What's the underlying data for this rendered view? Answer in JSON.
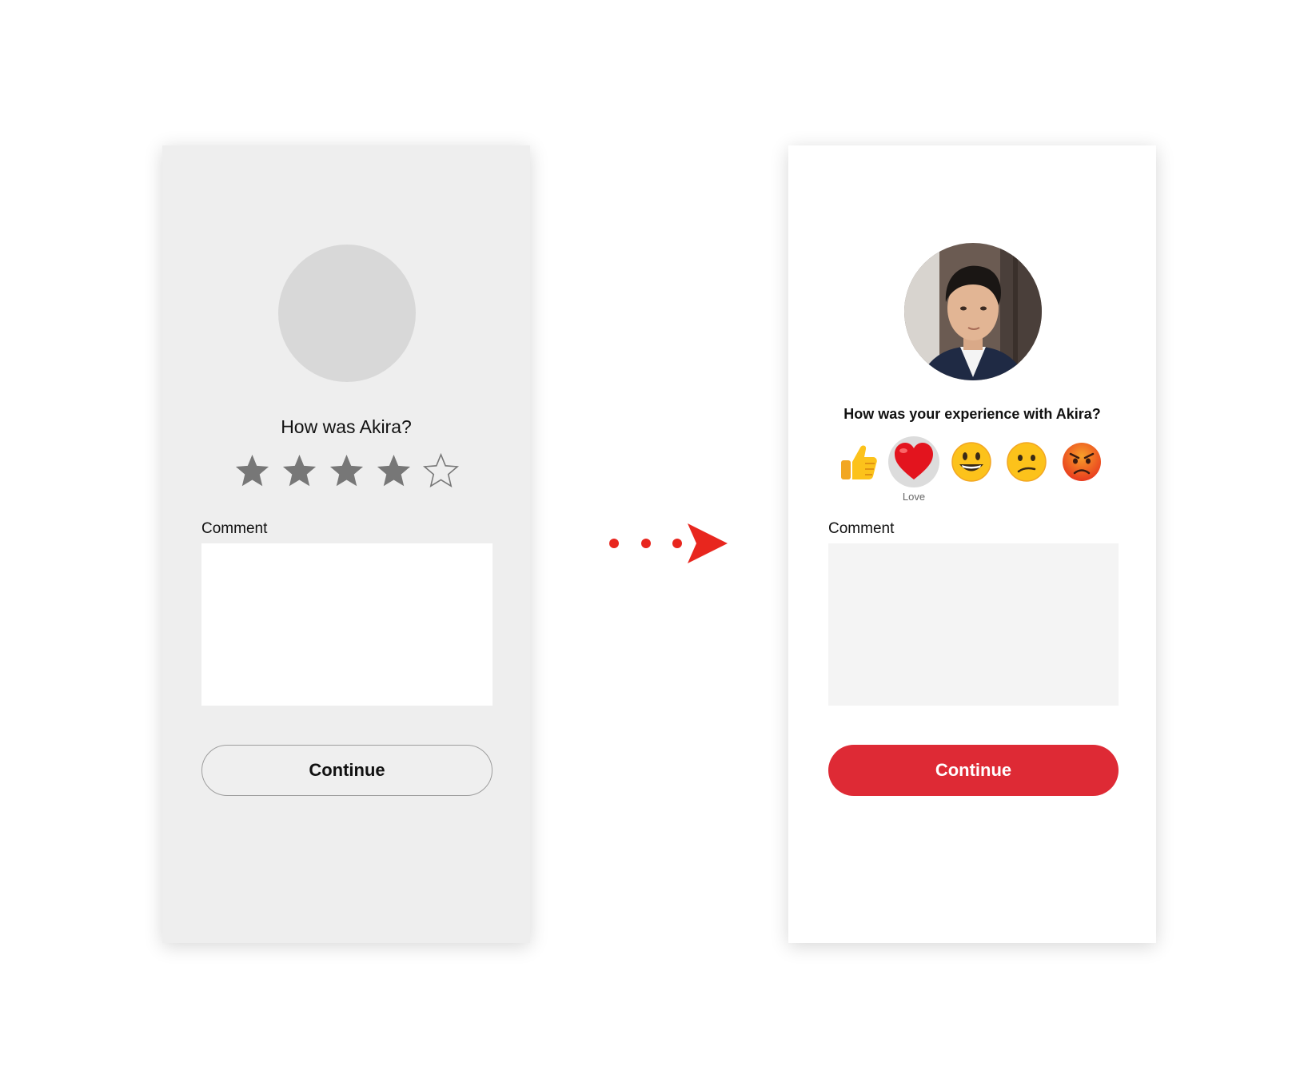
{
  "wireframe": {
    "question": "How was Akira?",
    "rating": {
      "filled": 4,
      "total": 5
    },
    "comment_label": "Comment",
    "continue_label": "Continue"
  },
  "final": {
    "question": "How was your experience with Akira?",
    "reactions": [
      {
        "icon": "thumbs-up-icon",
        "label": ""
      },
      {
        "icon": "heart-icon",
        "label": "Love",
        "selected": true
      },
      {
        "icon": "smiley-icon",
        "label": ""
      },
      {
        "icon": "confused-face-icon",
        "label": ""
      },
      {
        "icon": "angry-face-icon",
        "label": ""
      }
    ],
    "selected_reaction_label": "Love",
    "comment_label": "Comment",
    "continue_label": "Continue"
  },
  "colors": {
    "accent": "#de2a35",
    "wire_bg": "#eeeeee",
    "star": "#777777"
  }
}
